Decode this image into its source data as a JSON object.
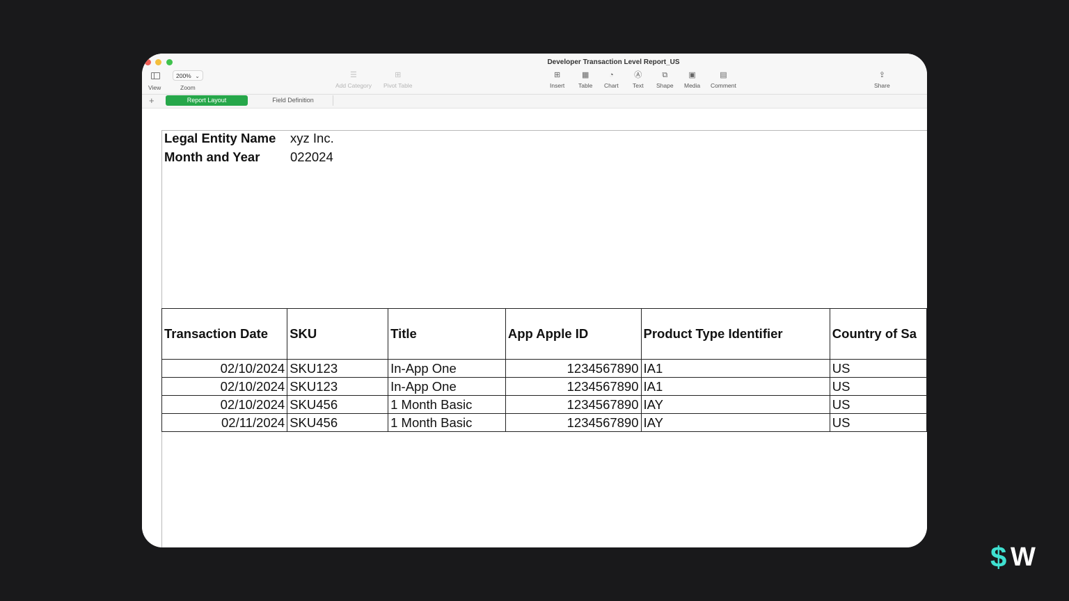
{
  "window": {
    "title": "Developer Transaction Level Report_US"
  },
  "toolbar": {
    "view_label": "View",
    "zoom_value": "200%",
    "zoom_label": "Zoom",
    "add_category": "Add Category",
    "pivot_table": "Pivot Table",
    "insert": "Insert",
    "table": "Table",
    "chart": "Chart",
    "text": "Text",
    "shape": "Shape",
    "media": "Media",
    "comment": "Comment",
    "share": "Share"
  },
  "sheets": {
    "add": "+",
    "tabs": [
      {
        "label": "Report Layout",
        "active": true
      },
      {
        "label": "Field Definition",
        "active": false
      }
    ]
  },
  "report": {
    "info": [
      {
        "label": "Legal Entity Name",
        "value": "xyz Inc."
      },
      {
        "label": "Month and Year",
        "value": "022024"
      }
    ],
    "columns": [
      "Transaction Date",
      "SKU",
      "Title",
      "App Apple ID",
      "Product Type Identifier",
      "Country of Sa"
    ],
    "rows": [
      [
        "02/10/2024",
        "SKU123",
        "In-App One",
        "1234567890",
        "IA1",
        "US"
      ],
      [
        "02/10/2024",
        "SKU123",
        "In-App One",
        "1234567890",
        "IA1",
        "US"
      ],
      [
        "02/10/2024",
        "SKU456",
        "1 Month Basic",
        "1234567890",
        "IAY",
        "US"
      ],
      [
        "02/11/2024",
        "SKU456",
        "1 Month Basic",
        "1234567890",
        "IAY",
        "US"
      ]
    ]
  },
  "brand": {
    "logo_text": "$W",
    "accent": "#3fe0d0",
    "tab_active_color": "#26a74a"
  }
}
